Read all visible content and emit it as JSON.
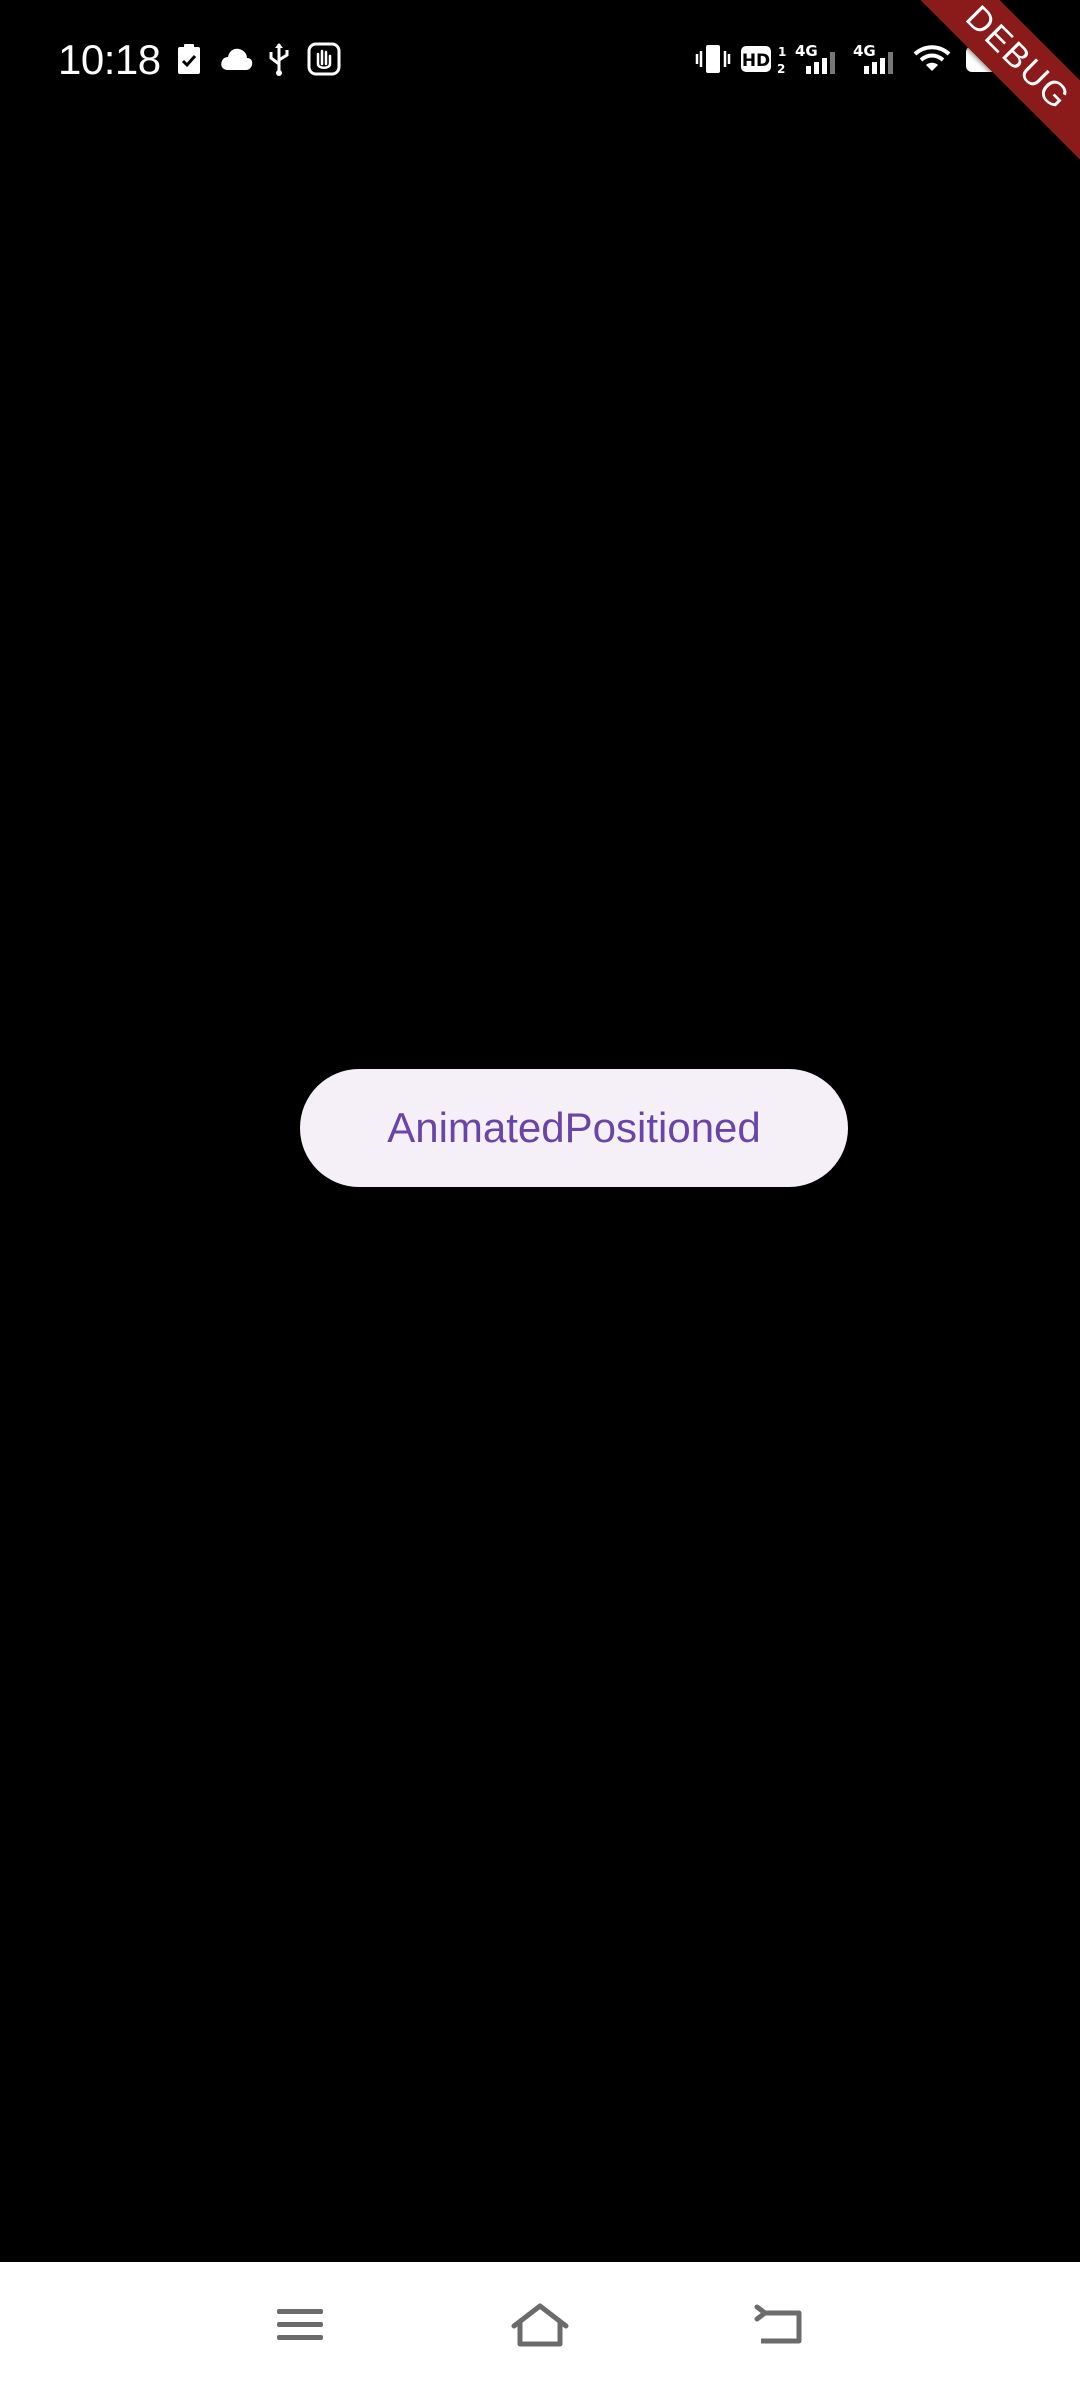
{
  "status_bar": {
    "time": "10:18",
    "icons": [
      "task-check-icon",
      "cloud-icon",
      "usb-icon",
      "hand-icon",
      "vibrate-icon",
      "hd-icon",
      "signal-4g-icon",
      "signal-4g-icon",
      "wifi-icon",
      "battery-icon"
    ],
    "network_1": "4G",
    "network_2": "4G",
    "hd_label": "HD"
  },
  "debug_banner": {
    "label": "DEBUG",
    "color": "#8b1a1a"
  },
  "main": {
    "button_label": "AnimatedPositioned",
    "button_bg": "#f5eff7",
    "button_text_color": "#6a44a9"
  },
  "nav_bar": {
    "icons": [
      "menu-icon",
      "home-icon",
      "back-icon"
    ]
  }
}
